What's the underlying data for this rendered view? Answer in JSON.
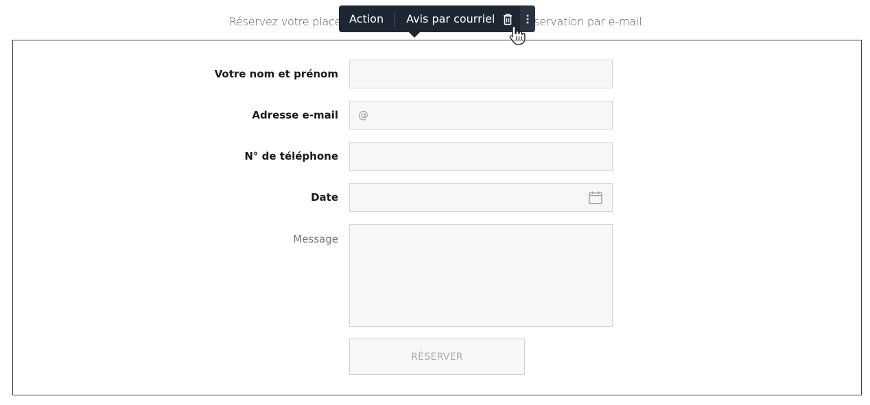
{
  "intro": {
    "left_text": "Réservez votre place",
    "middle_text": "s",
    "right_text": "éservation par e-mail."
  },
  "toolbar": {
    "action_label": "Action",
    "notify_label": "Avis par courriel",
    "trash_icon": "trash-icon",
    "more_icon": "more-vertical-icon"
  },
  "form": {
    "name_label": "Votre nom et prénom",
    "name_value": "",
    "email_label": "Adresse e-mail",
    "email_placeholder": "@",
    "phone_label": "N° de téléphone",
    "phone_value": "",
    "date_label": "Date",
    "date_value": "",
    "message_label": "Message",
    "message_value": "",
    "submit_label": "RÉSERVER"
  },
  "colors": {
    "toolbar_bg": "#1f2633",
    "field_bg": "#f7f7f7",
    "field_border": "#d4d4d4"
  }
}
